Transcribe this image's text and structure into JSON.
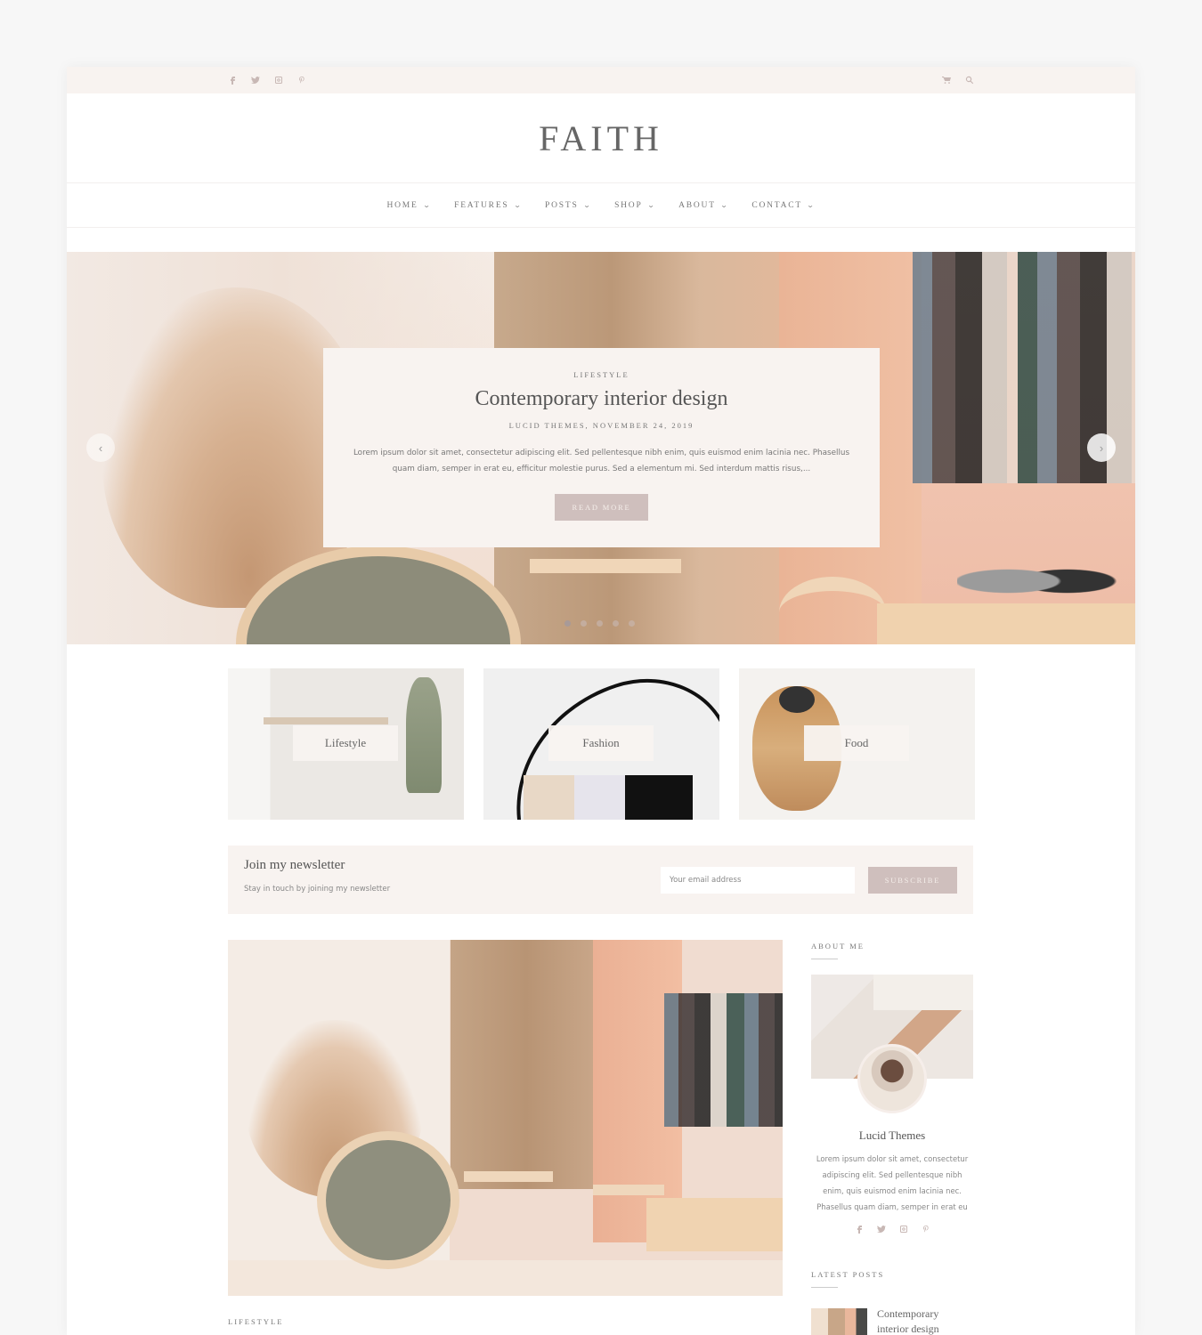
{
  "topbar": {
    "social_icons": [
      "facebook-icon",
      "twitter-icon",
      "instagram-icon",
      "pinterest-icon"
    ],
    "tool_icons": [
      "cart-icon",
      "search-icon"
    ]
  },
  "brand": {
    "title": "FAITH"
  },
  "nav": {
    "items": [
      {
        "label": "HOME"
      },
      {
        "label": "FEATURES"
      },
      {
        "label": "POSTS"
      },
      {
        "label": "SHOP"
      },
      {
        "label": "ABOUT"
      },
      {
        "label": "CONTACT"
      }
    ]
  },
  "slider": {
    "category": "LIFESTYLE",
    "title": "Contemporary interior design",
    "meta": "LUCID THEMES, NOVEMBER 24, 2019",
    "excerpt": "Lorem ipsum dolor sit amet, consectetur adipiscing elit. Sed pellentesque nibh enim, quis euismod enim lacinia nec. Phasellus quam diam, semper in erat eu, efficitur molestie purus. Sed a elementum mi. Sed interdum mattis risus,...",
    "button": "READ MORE",
    "prev_icon": "‹",
    "next_icon": "›",
    "slide_count": 5,
    "active_slide": 1
  },
  "categories": [
    {
      "label": "Lifestyle"
    },
    {
      "label": "Fashion"
    },
    {
      "label": "Food"
    }
  ],
  "newsletter": {
    "title": "Join my newsletter",
    "subtitle": "Stay in touch by joining my newsletter",
    "placeholder": "Your email address",
    "button": "SUBSCRIBE"
  },
  "featured_post": {
    "category": "LIFESTYLE"
  },
  "sidebar": {
    "about": {
      "title": "ABOUT ME",
      "name": "Lucid Themes",
      "text": "Lorem ipsum dolor sit amet, consectetur adipiscing elit. Sed pellentesque nibh enim, quis euismod enim lacinia nec. Phasellus quam diam, semper in erat eu"
    },
    "latest": {
      "title": "LATEST POSTS",
      "items": [
        {
          "title": "Contemporary interior design"
        }
      ]
    }
  }
}
